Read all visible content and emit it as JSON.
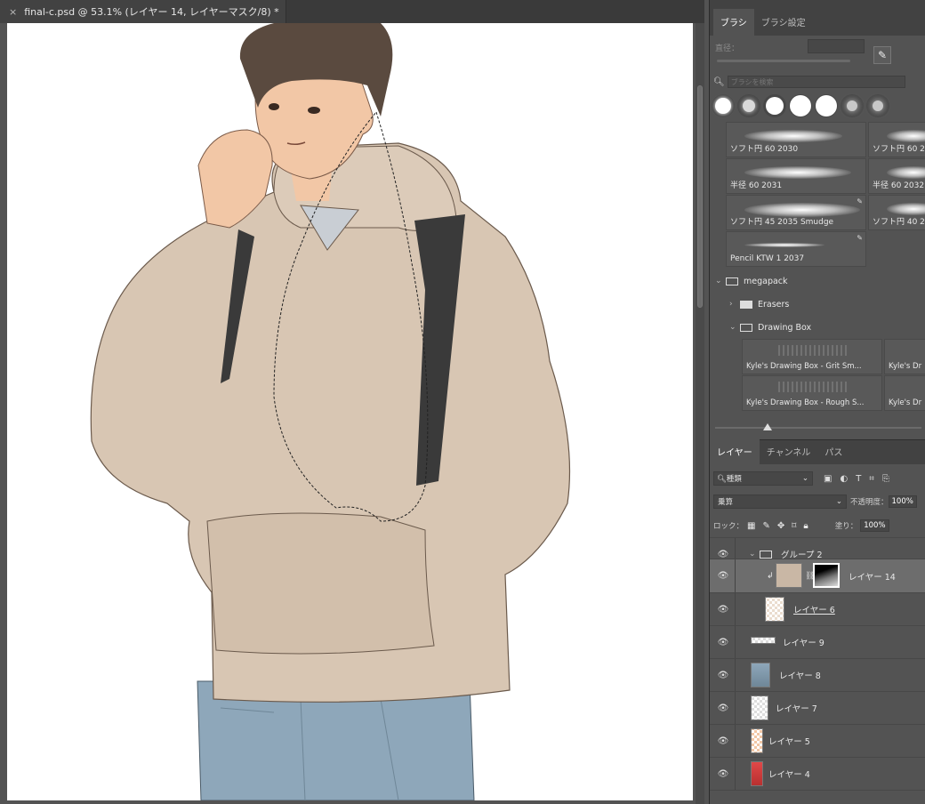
{
  "document": {
    "tab_title": "final-c.psd @ 53.1% (レイヤー 14, レイヤーマスク/8) *",
    "close_glyph": "×"
  },
  "brush_panel": {
    "tabs": [
      "ブラシ",
      "ブラシ設定"
    ],
    "size_label": "直径：",
    "search_placeholder": "ブラシを検索",
    "presets": [
      {
        "label": "ソフト円 60 2030"
      },
      {
        "label": "ソフト円 60 2"
      },
      {
        "label": "半径 60 2031"
      },
      {
        "label": "半径 60 2032"
      },
      {
        "label": "ソフト円 45 2035 Smudge"
      },
      {
        "label": "ソフト円 40 2"
      },
      {
        "label": "Pencil KTW 1 2037"
      }
    ],
    "folders": [
      {
        "label": "megapack"
      },
      {
        "label": "Erasers"
      },
      {
        "label": "Drawing Box"
      }
    ],
    "kyle_presets": [
      {
        "label": "Kyle's Drawing Box - Grit Sm..."
      },
      {
        "label": "Kyle's Dr"
      },
      {
        "label": "Kyle's Drawing Box - Rough S..."
      },
      {
        "label": "Kyle's Dr"
      }
    ]
  },
  "layers_panel": {
    "tabs": [
      "レイヤー",
      "チャンネル",
      "パス"
    ],
    "filter_kind": "種類",
    "blend_mode": "乗算",
    "opacity_label": "不透明度：",
    "opacity_value": "100%",
    "lock_label": "ロック：",
    "fill_label": "塗り：",
    "fill_value": "100%",
    "layers": [
      {
        "name": "グループ 2"
      },
      {
        "name": "レイヤー 14"
      },
      {
        "name": "レイヤー 6"
      },
      {
        "name": "レイヤー 9"
      },
      {
        "name": "レイヤー 8"
      },
      {
        "name": "レイヤー 7"
      },
      {
        "name": "レイヤー 5"
      },
      {
        "name": "レイヤー 4"
      }
    ]
  },
  "colors": {
    "hoodie": "#d8c6b3",
    "jeans": "#8ea7ba",
    "skin": "#f2c7a6",
    "hair": "#5a4a3f",
    "strap": "#3a3a3a"
  }
}
